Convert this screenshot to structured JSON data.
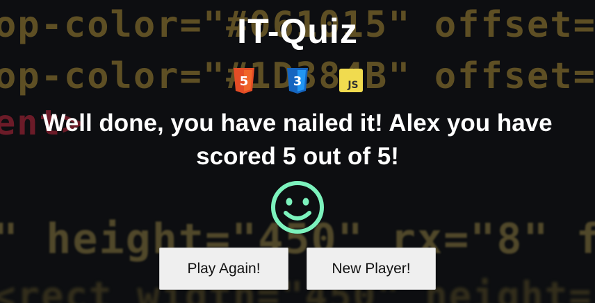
{
  "title": "IT-Quiz",
  "icons": [
    "html5-icon",
    "css3-icon",
    "javascript-icon"
  ],
  "result": {
    "line1": "Well done, you have nailed it! Alex you have",
    "line2": "scored 5 out of 5!"
  },
  "buttons": {
    "play_again": "Play Again!",
    "new_player": "New Player!"
  },
  "colors": {
    "smiley": "#7cf2bd",
    "html5": "#e44d26",
    "css3": "#1e88e5",
    "javascript": "#f0db4f"
  }
}
